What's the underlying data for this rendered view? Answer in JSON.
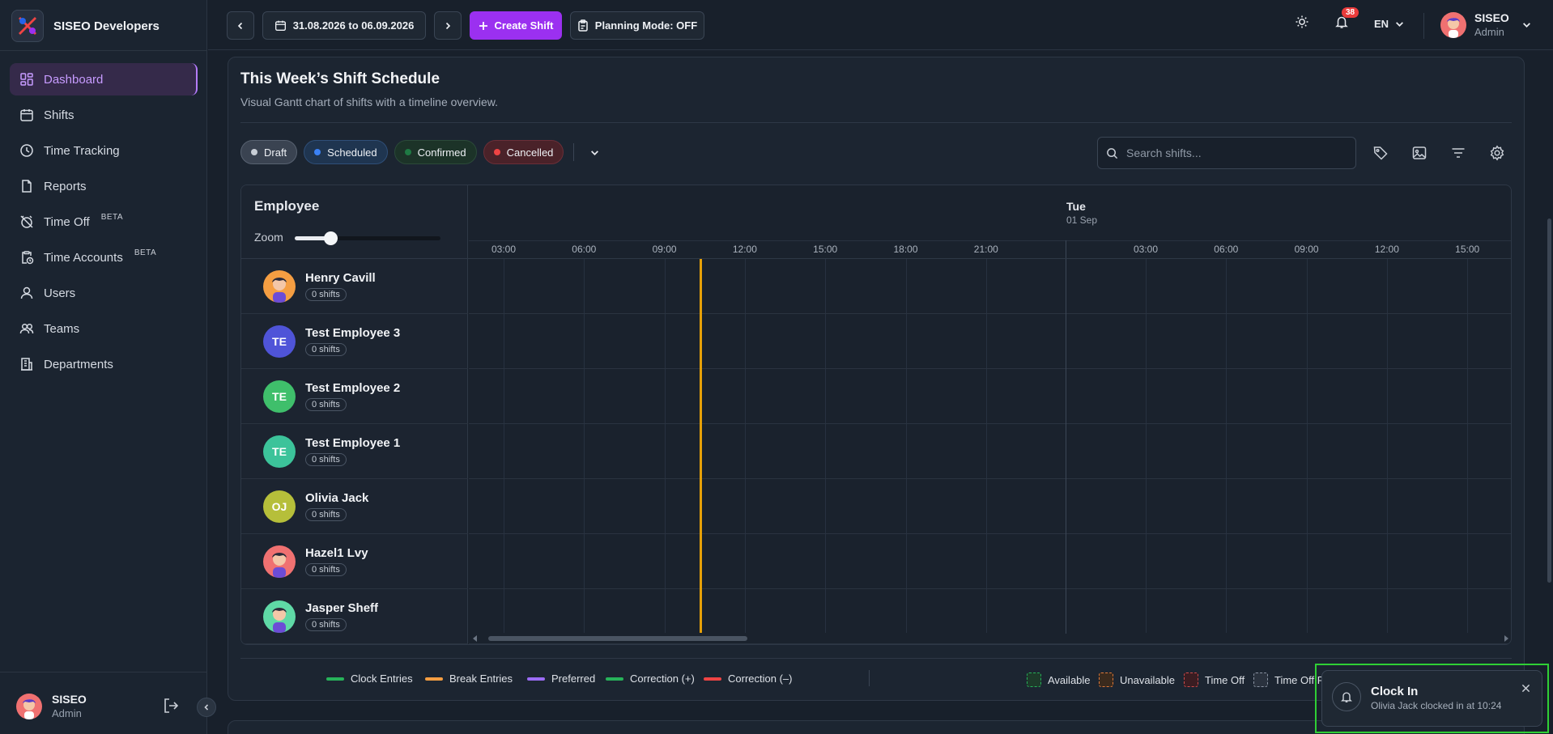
{
  "app": {
    "brand_name": "SISEO Developers",
    "accent": "#9b30f0"
  },
  "sidebar": {
    "items": [
      {
        "label": "Dashboard",
        "icon": "dashboard-icon",
        "active": true
      },
      {
        "label": "Shifts",
        "icon": "calendar-icon"
      },
      {
        "label": "Time Tracking",
        "icon": "clock-icon"
      },
      {
        "label": "Reports",
        "icon": "document-icon"
      },
      {
        "label": "Time Off",
        "icon": "alarm-off-icon",
        "badge": "BETA"
      },
      {
        "label": "Time Accounts",
        "icon": "clipboard-clock-icon",
        "badge": "BETA"
      },
      {
        "label": "Users",
        "icon": "user-icon"
      },
      {
        "label": "Teams",
        "icon": "users-icon"
      },
      {
        "label": "Departments",
        "icon": "building-icon"
      }
    ],
    "user": {
      "name": "SISEO",
      "role": "Admin"
    }
  },
  "topbar": {
    "date_range": "31.08.2026 to 06.09.2026",
    "create_label": "Create Shift",
    "planning_label": "Planning Mode: OFF",
    "notif_count": "38",
    "language": "EN",
    "user": {
      "name": "SISEO",
      "role": "Admin"
    }
  },
  "schedule": {
    "title": "This Week’s Shift Schedule",
    "subtitle": "Visual Gantt chart of shifts with a timeline overview.",
    "chips": [
      {
        "label": "Draft",
        "color": "#c8ced6"
      },
      {
        "label": "Scheduled",
        "color": "#3b82f6"
      },
      {
        "label": "Confirmed",
        "color": "#1f7a44"
      },
      {
        "label": "Cancelled",
        "color": "#ef4444"
      }
    ],
    "search_placeholder": "Search shifts...",
    "employee_header": "Employee",
    "zoom_label": "Zoom",
    "zoom_level": 0.2,
    "day2": {
      "name": "Tue",
      "date": "01 Sep"
    },
    "hours_day1": [
      "03:00",
      "06:00",
      "09:00",
      "12:00",
      "15:00",
      "18:00",
      "21:00"
    ],
    "hours_day2": [
      "03:00",
      "06:00",
      "09:00",
      "12:00",
      "15:00"
    ],
    "employees": [
      {
        "name": "Henry Cavill",
        "initials": "",
        "shifts": "0 shifts",
        "avatar_color": "#f59e42",
        "photo": true
      },
      {
        "name": "Test Employee 3",
        "initials": "TE",
        "shifts": "0 shifts",
        "avatar_color": "#4f54d8"
      },
      {
        "name": "Test Employee 2",
        "initials": "TE",
        "shifts": "0 shifts",
        "avatar_color": "#3fbf6b"
      },
      {
        "name": "Test Employee 1",
        "initials": "TE",
        "shifts": "0 shifts",
        "avatar_color": "#3cc39a"
      },
      {
        "name": "Olivia Jack",
        "initials": "OJ",
        "shifts": "0 shifts",
        "avatar_color": "#b6bf3a"
      },
      {
        "name": "Hazel1 Lvy",
        "initials": "",
        "shifts": "0 shifts",
        "avatar_color": "#f07171",
        "photo": true
      },
      {
        "name": "Jasper Sheff",
        "initials": "",
        "shifts": "0 shifts",
        "avatar_color": "#5fd9a6",
        "photo": true
      }
    ]
  },
  "legend": {
    "lines": [
      {
        "label": "Clock Entries",
        "color": "#27b35a"
      },
      {
        "label": "Break Entries",
        "color": "#f59e42"
      },
      {
        "label": "Preferred",
        "color": "#9b6cf5"
      },
      {
        "label": "Correction (+)",
        "color": "#27b35a"
      },
      {
        "label": "Correction (–)",
        "color": "#ef4444"
      }
    ],
    "boxes": [
      {
        "label": "Available",
        "color": "#27b35a"
      },
      {
        "label": "Unavailable",
        "color": "#e07a3a"
      },
      {
        "label": "Time Off",
        "color": "#d04a4a"
      },
      {
        "label": "Time Off P",
        "color": "#8a94a3"
      }
    ]
  },
  "toast": {
    "title": "Clock In",
    "message": "Olivia Jack clocked in at 10:24"
  }
}
